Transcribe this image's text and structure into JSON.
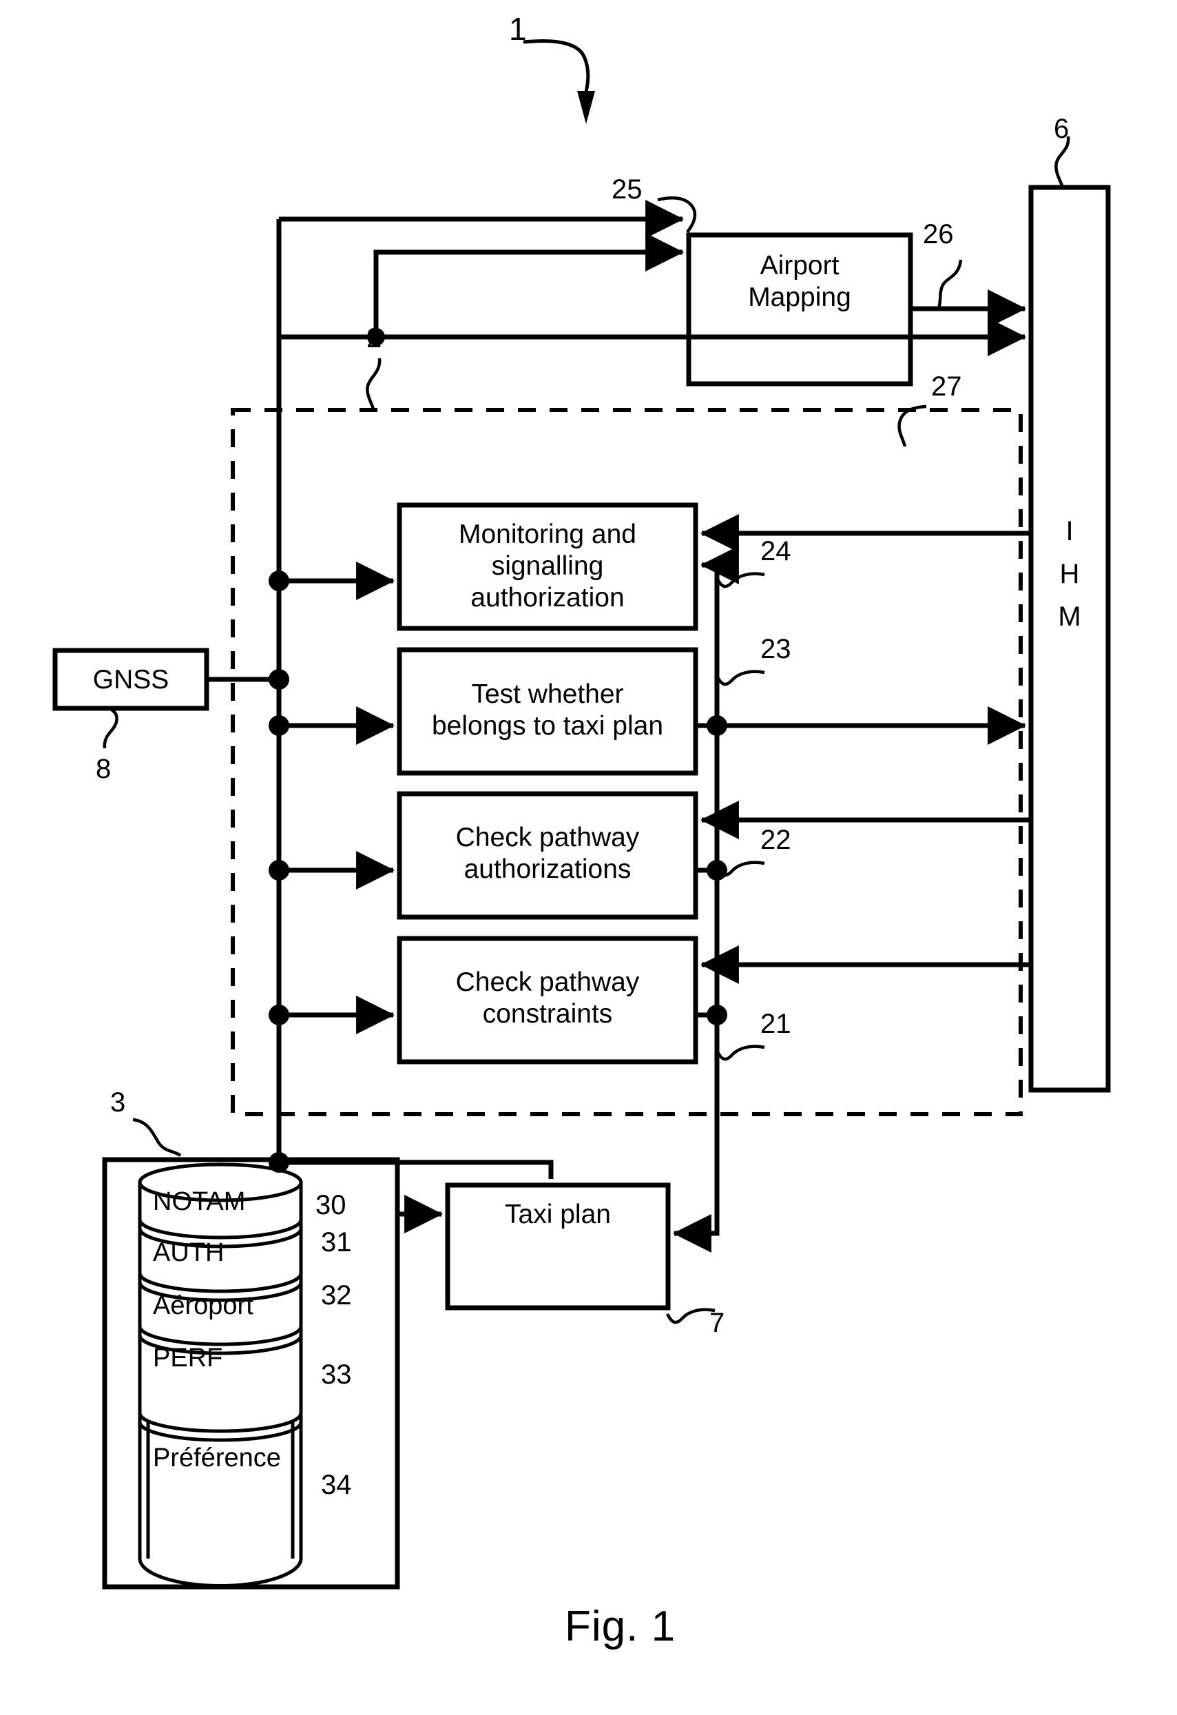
{
  "figure": {
    "caption": "Fig. 1",
    "system_label": "1"
  },
  "blocks": {
    "airport_mapping": {
      "label": "Airport\nMapping",
      "ref": "25",
      "out_ref": "26"
    },
    "monitoring": {
      "label": "Monitoring and\nsignalling\nauthorization",
      "ref": "24"
    },
    "test_taxi": {
      "label": "Test whether\nbelongs to taxi plan",
      "ref": "23"
    },
    "check_auth": {
      "label": "Check pathway\nauthorizations",
      "ref": "22"
    },
    "check_constraints": {
      "label": "Check pathway\nconstraints",
      "ref": "21"
    },
    "gnss": {
      "label": "GNSS",
      "ref": "8"
    },
    "taxi_plan": {
      "label": "Taxi plan",
      "ref": "7"
    },
    "ihm": {
      "label": "I\nH\nM",
      "ref": "6"
    },
    "processing_unit": {
      "ref": "2",
      "bus_ref": "27"
    },
    "database_container": {
      "ref": "3"
    }
  },
  "database": {
    "ref": "3",
    "layers": [
      {
        "name": "NOTAM",
        "ref": "30"
      },
      {
        "name": "AUTH",
        "ref": "31"
      },
      {
        "name": "Aéroport",
        "ref": "32"
      },
      {
        "name": "PERF",
        "ref": "33"
      },
      {
        "name": "Préférence",
        "ref": "34"
      }
    ]
  },
  "ihm_letters": {
    "l1": "I",
    "l2": "H",
    "l3": "M"
  },
  "colors": {
    "stroke": "#000000",
    "background": "#ffffff"
  }
}
